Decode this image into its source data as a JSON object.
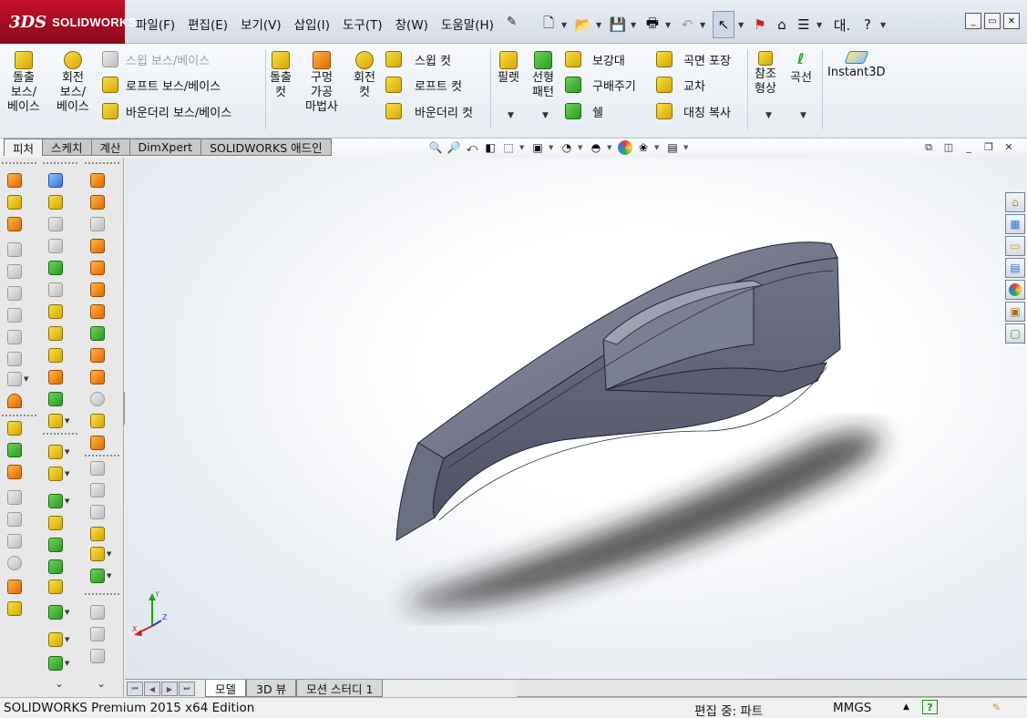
{
  "app": {
    "logo_mark": "3DS",
    "logo_text": "SOLIDWORKS"
  },
  "menu": [
    "파일(F)",
    "편집(E)",
    "보기(V)",
    "삽입(I)",
    "도구(T)",
    "창(W)",
    "도움말(H)"
  ],
  "quick_access": {
    "search_label": "대.",
    "help_label": "?"
  },
  "command_manager": {
    "extrude_boss": [
      "돌출",
      "보스/",
      "베이스"
    ],
    "revolve_boss": [
      "회전",
      "보스/",
      "베이스"
    ],
    "swept_boss": "스윕 보스/베이스",
    "loft_boss": "로프트 보스/베이스",
    "boundary_boss": "바운더리 보스/베이스",
    "extrude_cut": [
      "돌출",
      "컷"
    ],
    "hole_wizard": [
      "구멍",
      "가공",
      "마법사"
    ],
    "revolve_cut": [
      "회전",
      "컷"
    ],
    "swept_cut": "스윕 컷",
    "loft_cut": "로프트 컷",
    "boundary_cut": "바운더리 컷",
    "fillet": "필렛",
    "linear_pattern": [
      "선형",
      "패턴"
    ],
    "rib": "보강대",
    "draft": "구배주기",
    "shell": "쉘",
    "wrap": "곡면 포장",
    "intersect": "교차",
    "mirror": "대칭 복사",
    "ref_geometry": [
      "참조",
      "형상"
    ],
    "curves": "곡선",
    "instant3d": "Instant3D"
  },
  "cm_tabs": [
    "피처",
    "스케치",
    "계산",
    "DimXpert",
    "SOLIDWORKS 애드인"
  ],
  "triad": {
    "x": "X",
    "y": "Y",
    "z": "Z"
  },
  "bottom_tabs": [
    "모델",
    "3D 뷰",
    "모션 스터디 1"
  ],
  "status": {
    "edition": "SOLIDWORKS Premium 2015 x64 Edition",
    "editing": "편집 중: 파트",
    "units": "MMGS"
  },
  "colors": {
    "brand_red": "#c3102a",
    "part_body": "#6f7385",
    "viewport_bg": "#eef1f6"
  }
}
